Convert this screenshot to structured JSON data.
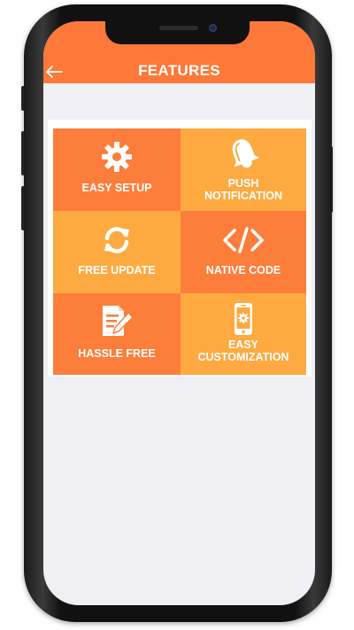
{
  "header": {
    "title": "FEATURES",
    "back_icon": "arrow-left-icon",
    "color": "#fe7839"
  },
  "colors": {
    "tile_dark": "#fd7d3b",
    "tile_light": "#feaa40",
    "screen_bg": "#efeff4"
  },
  "features": [
    {
      "label": "EASY SETUP",
      "icon": "gear-icon"
    },
    {
      "label": "PUSH NOTIFICATION",
      "icon": "bell-icon"
    },
    {
      "label": "FREE UPDATE",
      "icon": "refresh-icon"
    },
    {
      "label": "NATIVE CODE",
      "icon": "code-icon"
    },
    {
      "label": "HASSLE FREE",
      "icon": "document-edit-icon"
    },
    {
      "label": "EASY CUSTOMIZATION",
      "icon": "mobile-settings-icon"
    }
  ]
}
